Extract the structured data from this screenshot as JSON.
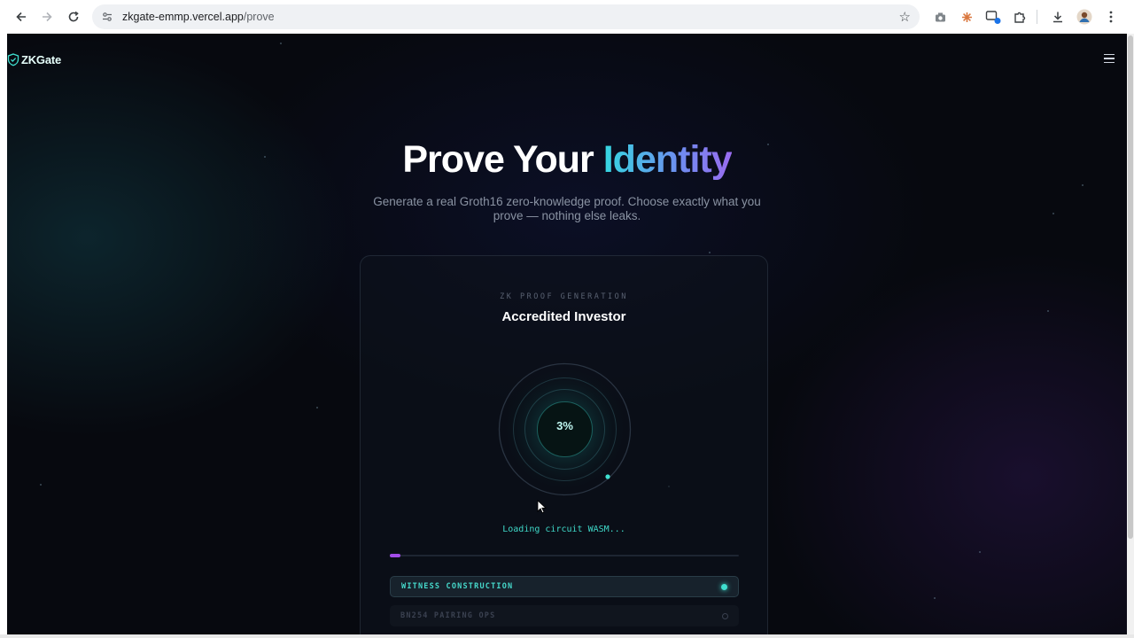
{
  "browser": {
    "url_host": "zkgate-emmp.vercel.app",
    "url_path": "/prove"
  },
  "site": {
    "logo_text": "ZKGate"
  },
  "hero": {
    "title_plain": "Prove Your",
    "title_accent": "Identity",
    "subtitle": "Generate a real Groth16 zero-knowledge proof. Choose exactly what you prove — nothing else leaks."
  },
  "card": {
    "eyebrow": "ZK PROOF GENERATION",
    "title": "Accredited Investor",
    "progress_label": "3%",
    "progress_fraction": 0.03,
    "status": "Loading circuit WASM...",
    "steps": [
      {
        "label": "WITNESS CONSTRUCTION",
        "state": "active"
      },
      {
        "label": "BN254 PAIRING OPS",
        "state": "pending"
      }
    ]
  },
  "colors": {
    "accent_teal": "#3fe0d0",
    "accent_purple": "#a24ce8",
    "background": "#07090f"
  }
}
